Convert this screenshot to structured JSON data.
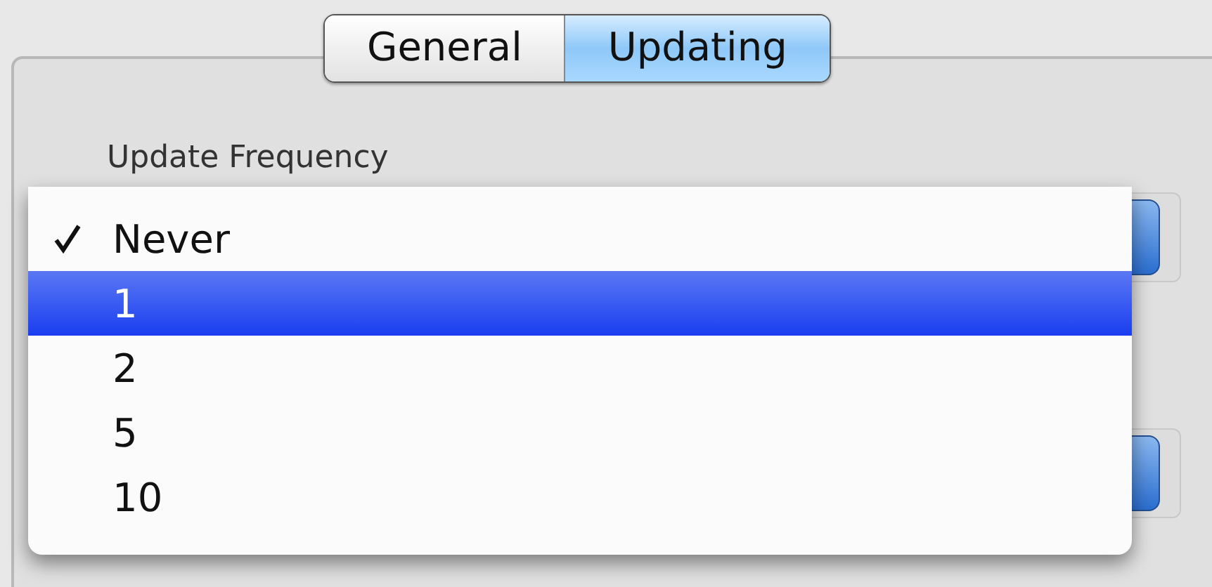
{
  "tabs": [
    {
      "label": "General",
      "selected": false
    },
    {
      "label": "Updating",
      "selected": true
    }
  ],
  "update_frequency": {
    "label": "Update Frequency",
    "menu": [
      {
        "label": "Never",
        "checked": true,
        "selected": false
      },
      {
        "label": "1",
        "checked": false,
        "selected": true
      },
      {
        "label": "2",
        "checked": false,
        "selected": false
      },
      {
        "label": "5",
        "checked": false,
        "selected": false
      },
      {
        "label": "10",
        "checked": false,
        "selected": false
      }
    ]
  }
}
